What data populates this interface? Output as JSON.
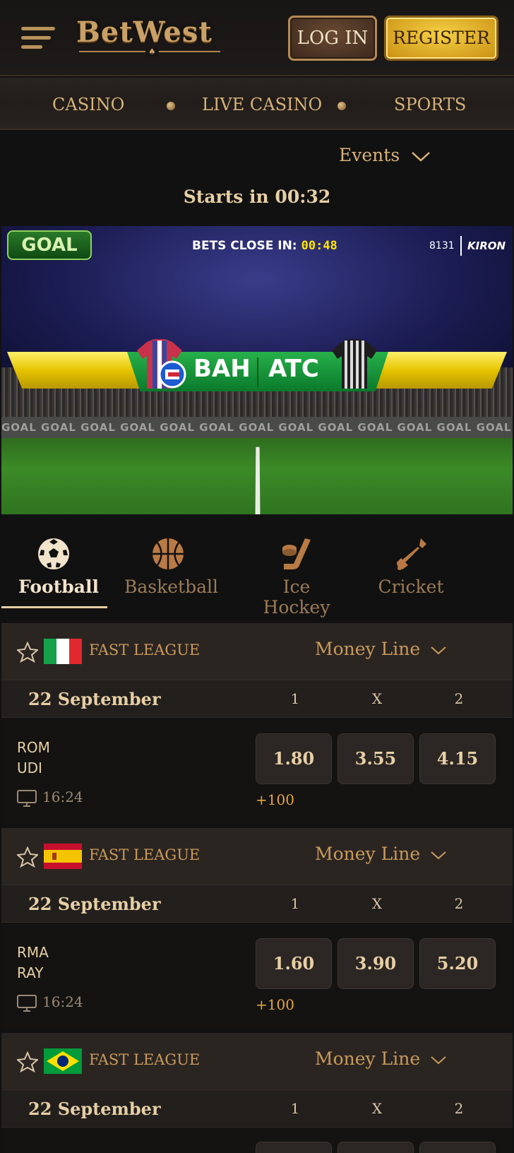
{
  "header": {
    "brand": "BetWest",
    "login_label": "LOG IN",
    "register_label": "REGISTER"
  },
  "nav": {
    "items": [
      "CASINO",
      "LIVE CASINO",
      "SPORTS"
    ]
  },
  "events_label": "Events",
  "starts_in": "Starts in 00:32",
  "banner": {
    "logo": "GOAL",
    "bets_close_label": "BETS CLOSE IN:",
    "bets_close_time": "00:48",
    "event_number": "8131",
    "provider": "KIRON",
    "home_team": "BAH",
    "away_team": "ATC",
    "board_text": "GOAL  GOAL  GOAL  GOAL  GOAL  GOAL  GOAL  GOAL  GOAL  GOAL  GOAL  GOAL  GOAL"
  },
  "sport_tabs": [
    {
      "label": "Football",
      "icon": "soccer-ball-icon",
      "active": true
    },
    {
      "label": "Basketball",
      "icon": "basketball-icon",
      "active": false
    },
    {
      "label": "Ice Hockey",
      "icon": "hockey-stick-icon",
      "active": false
    },
    {
      "label": "Cricket",
      "icon": "cricket-bat-icon",
      "active": false
    }
  ],
  "columns": [
    "1",
    "X",
    "2"
  ],
  "leagues": [
    {
      "name": "FAST LEAGUE",
      "flag": "italy-flag-icon",
      "market": "Money Line",
      "date": "22 September",
      "match": {
        "home": "ROM",
        "away": "UDI",
        "time": "16:24",
        "odds": [
          "1.80",
          "3.55",
          "4.15"
        ],
        "more": "+100"
      }
    },
    {
      "name": "FAST LEAGUE",
      "flag": "spain-flag-icon",
      "market": "Money Line",
      "date": "22 September",
      "match": {
        "home": "RMA",
        "away": "RAY",
        "time": "16:24",
        "odds": [
          "1.60",
          "3.90",
          "5.20"
        ],
        "more": "+100"
      }
    },
    {
      "name": "FAST LEAGUE",
      "flag": "brazil-flag-icon",
      "market": "Money Line",
      "date": "22 September"
    }
  ],
  "colors": {
    "background": "#121111",
    "gold": "#c89a5c",
    "register_yellow": "#f5d044",
    "accent_orange": "#e6a63a"
  }
}
